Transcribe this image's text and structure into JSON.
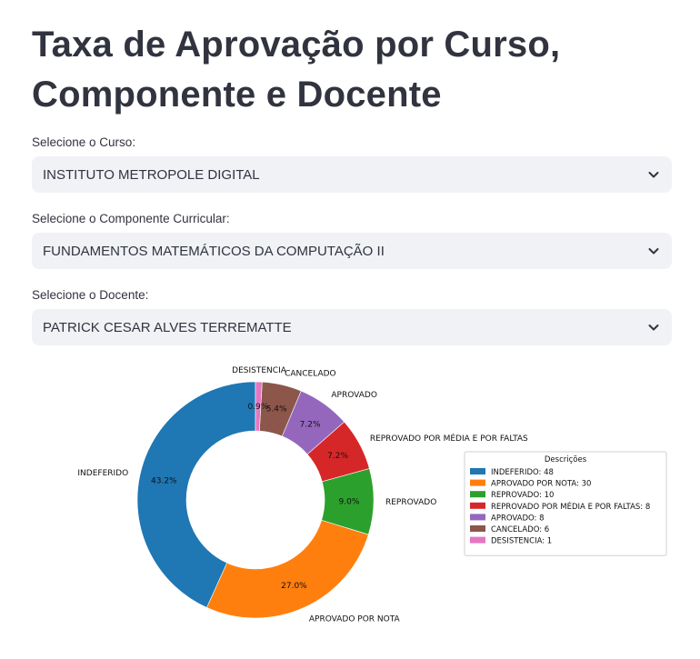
{
  "page": {
    "title_line1": "Taxa de Aprovação por Curso,",
    "title_line2": "Componente e Docente"
  },
  "filters": {
    "curso": {
      "label": "Selecione o Curso:",
      "value": "INSTITUTO METROPOLE DIGITAL"
    },
    "componente": {
      "label": "Selecione o Componente Curricular:",
      "value": "FUNDAMENTOS MATEMÁTICOS DA COMPUTAÇÃO II"
    },
    "docente": {
      "label": "Selecione o Docente:",
      "value": "PATRICK CESAR ALVES TERREMATTE"
    }
  },
  "chart_data": {
    "type": "pie",
    "style": "donut",
    "legend_title": "Descrições",
    "legend_placement": "right",
    "slices": [
      {
        "label": "INDEFERIDO",
        "value": 48,
        "pct": "43.2%",
        "legend": "INDEFERIDO: 48",
        "color": "#1f77b4"
      },
      {
        "label": "APROVADO POR NOTA",
        "value": 30,
        "pct": "27.0%",
        "legend": "APROVADO POR NOTA: 30",
        "color": "#ff7f0e"
      },
      {
        "label": "REPROVADO",
        "value": 10,
        "pct": "9.0%",
        "legend": "REPROVADO: 10",
        "color": "#2ca02c"
      },
      {
        "label": "REPROVADO POR MÉDIA E POR FALTAS",
        "value": 8,
        "pct": "7.2%",
        "legend": "REPROVADO POR MÉDIA E POR FALTAS: 8",
        "color": "#d62728"
      },
      {
        "label": "APROVADO",
        "value": 8,
        "pct": "7.2%",
        "legend": "APROVADO: 8",
        "color": "#9467bd"
      },
      {
        "label": "CANCELADO",
        "value": 6,
        "pct": "5.4%",
        "legend": "CANCELADO: 6",
        "color": "#8c564b"
      },
      {
        "label": "DESISTENCIA",
        "value": 1,
        "pct": "0.9%",
        "legend": "DESISTENCIA: 1",
        "color": "#e377c2"
      }
    ]
  }
}
